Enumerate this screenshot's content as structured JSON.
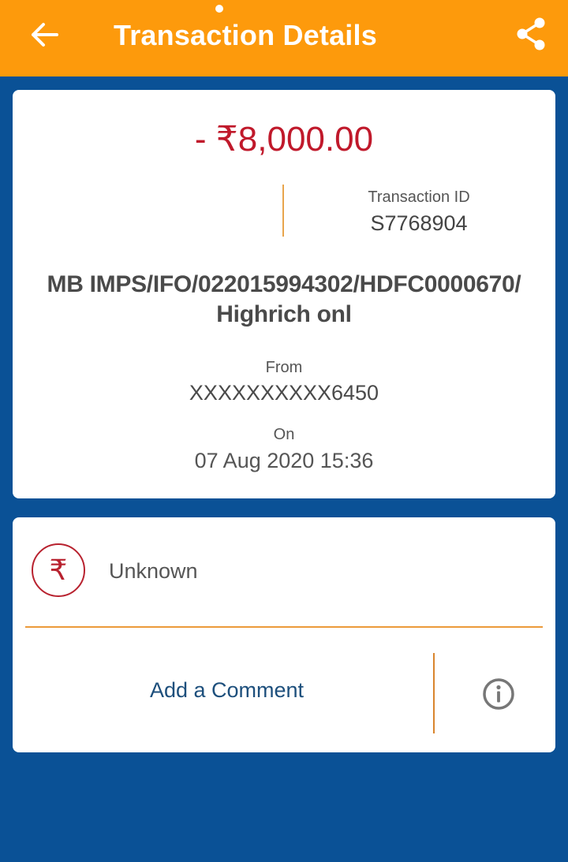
{
  "header": {
    "title": "Transaction Details",
    "icons": {
      "back": "arrow-left-icon",
      "share": "share-icon"
    },
    "colors": {
      "background": "#fd9a0c",
      "text": "#ffffff"
    }
  },
  "transaction": {
    "amount": "- ₹8,000.00",
    "amount_color": "#c0192b",
    "transaction_id_label": "Transaction ID",
    "transaction_id": "S7768904",
    "description": "MB IMPS/IFO/022015994302/HDFC0000670/ Highrich onl",
    "from_label": "From",
    "from_account": "XXXXXXXXXX6450",
    "on_label": "On",
    "date_time": "07 Aug 2020 15:36"
  },
  "category": {
    "icon": "rupee-icon",
    "symbol": "₹",
    "label": "Unknown"
  },
  "actions": {
    "add_comment_label": "Add a Comment",
    "info_icon": "info-icon"
  },
  "colors": {
    "page_background": "#0a5196",
    "accent": "#fd9a0c",
    "divider": "#ec9a3a",
    "link": "#1d4f7c"
  }
}
